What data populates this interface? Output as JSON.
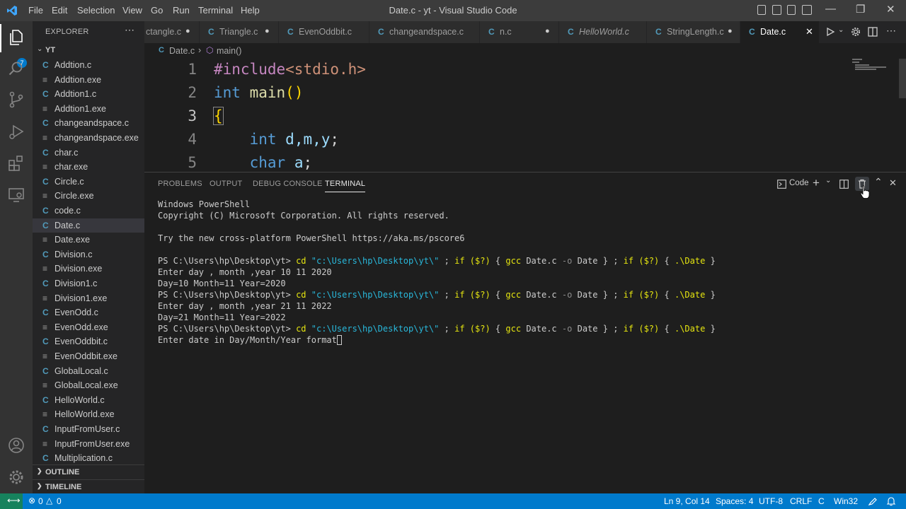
{
  "titlebar": {
    "menu": [
      "File",
      "Edit",
      "Selection",
      "View",
      "Go",
      "Run",
      "Terminal",
      "Help"
    ],
    "title": "Date.c - yt - Visual Studio Code"
  },
  "activitybar": {
    "explorer_badge": "7"
  },
  "sidebar": {
    "title": "EXPLORER",
    "folder": "YT",
    "files": [
      "Addtion.c",
      "Addtion.exe",
      "Addtion1.c",
      "Addtion1.exe",
      "changeandspace.c",
      "changeandspace.exe",
      "char.c",
      "char.exe",
      "Circle.c",
      "Circle.exe",
      "code.c",
      "Date.c",
      "Date.exe",
      "Division.c",
      "Division.exe",
      "Division1.c",
      "Division1.exe",
      "EvenOdd.c",
      "EvenOdd.exe",
      "EvenOddbit.c",
      "EvenOddbit.exe",
      "GlobalLocal.c",
      "GlobalLocal.exe",
      "HelloWorld.c",
      "HelloWorld.exe",
      "InputFromUser.c",
      "InputFromUser.exe",
      "Multiplication.c"
    ],
    "active_file": "Date.c",
    "outline": "OUTLINE",
    "timeline": "TIMELINE"
  },
  "tabs": [
    {
      "label": "ctangle.c",
      "dirty": true
    },
    {
      "label": "Triangle.c",
      "dirty": true
    },
    {
      "label": "EvenOddbit.c",
      "dirty": false
    },
    {
      "label": "changeandspace.c",
      "dirty": false
    },
    {
      "label": "n.c",
      "dirty": true
    },
    {
      "label": "HelloWorld.c",
      "dirty": false
    },
    {
      "label": "StringLength.c",
      "dirty": true
    },
    {
      "label": "Date.c",
      "dirty": false
    }
  ],
  "breadcrumb": {
    "file": "Date.c",
    "symbol": "main()"
  },
  "editor": {
    "line_numbers": [
      "1",
      "2",
      "3",
      "4",
      "5"
    ],
    "line1": {
      "directive": "#include",
      "header": "<stdio.h>"
    },
    "line2": {
      "type": "int",
      "name": "main",
      "parens": "()"
    },
    "line3": {
      "brace": "{"
    },
    "line4": {
      "type": "int",
      "vars": "d,m,y",
      "semi": ";"
    },
    "line5": {
      "type": "char",
      "vars": "a",
      "semi": ";"
    }
  },
  "panel": {
    "tabs": [
      "PROBLEMS",
      "OUTPUT",
      "DEBUG CONSOLE",
      "TERMINAL"
    ],
    "active_tab": "TERMINAL",
    "shell_label": "Code",
    "terminal": {
      "l1": "Windows PowerShell",
      "l2": "Copyright (C) Microsoft Corporation. All rights reserved.",
      "l3": "Try the new cross-platform PowerShell https://aka.ms/pscore6",
      "prompt": "PS C:\\Users\\hp\\Desktop\\yt>",
      "cmd": {
        "cd": "cd",
        "path": "\"c:\\Users\\hp\\Desktop\\yt\\\"",
        "sep1": ";",
        "if1": "if",
        "cond": "($?)",
        "open1": "{",
        "gcc": "gcc",
        "src": "Date.c",
        "flag": "-o",
        "out": "Date",
        "close1": "}",
        "sep2": ";",
        "if2": "if",
        "open2": "{",
        "run": ".\\Date",
        "close2": "}"
      },
      "o1": "Enter day , month ,year 10 11 2020",
      "o2": "Day=10 Month=11 Year=2020",
      "o3": "Enter day , month ,year 21 11 2022",
      "o4": "Day=21 Month=11 Year=2022",
      "o5": "Enter date in Day/Month/Year format"
    }
  },
  "statusbar": {
    "errors": "0",
    "warnings": "0",
    "position": "Ln 9, Col 14",
    "spaces": "Spaces: 4",
    "encoding": "UTF-8",
    "eol": "CRLF",
    "language": "C",
    "platform": "Win32"
  },
  "colors": {
    "accent": "#007acc",
    "remote": "#16825d",
    "c_icon": "#519aba"
  }
}
